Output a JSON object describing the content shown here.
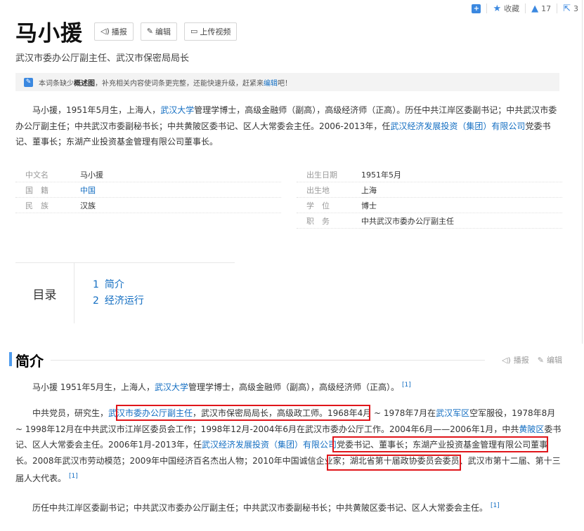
{
  "topbar": {
    "add_icon_label": "+",
    "collect": "收藏",
    "like_count": "17",
    "share_count": "3"
  },
  "title": "马小援",
  "title_buttons": {
    "report": "播报",
    "edit": "编辑",
    "upload_video": "上传视频"
  },
  "subtitle": "武汉市委办公厅副主任、武汉市保密局局长",
  "notice": {
    "text_before": "本词条缺少",
    "bold": "概述图",
    "text_middle": "，补充相关内容使词条更完整，还能快速升级，赶紧来",
    "link": "编辑",
    "text_after": "吧！"
  },
  "summary": {
    "p1": "马小援，1951年5月生，上海人，",
    "link1": "武汉大学",
    "p2": "管理学博士，高级金融师（副高），高级经济师（正高）。历任中共江岸区委副书记；中共武汉市委办公厅副主任；中共武汉市委副秘书长；中共黄陂区委书记、区人大常委会主任。2006-2013年，任",
    "link2": "武汉经济发展投资（集团）有限公司",
    "p3": "党委书记、董事长；东湖产业投资基金管理有限公司董事长。"
  },
  "info_left": [
    {
      "key": "中文名",
      "value": "马小援",
      "link": false
    },
    {
      "key": "国　籍",
      "value": "中国",
      "link": true
    },
    {
      "key": "民　族",
      "value": "汉族",
      "link": false
    }
  ],
  "info_right": [
    {
      "key": "出生日期",
      "value": "1951年5月"
    },
    {
      "key": "出生地",
      "value": "上海"
    },
    {
      "key": "学　位",
      "value": "博士"
    },
    {
      "key": "职　务",
      "value": "中共武汉市委办公厅副主任"
    }
  ],
  "toc": {
    "label": "目录",
    "items": [
      {
        "num": "1",
        "text": "简介"
      },
      {
        "num": "2",
        "text": "经济运行"
      }
    ]
  },
  "section": {
    "title": "简介",
    "report": "播报",
    "edit": "编辑"
  },
  "para1": {
    "a": "马小援 1951年5月生，上海人，",
    "link": "武汉大学",
    "b": "管理学博士，高级金融师（副高），高级经济师（正高）。",
    "ref": "[1]"
  },
  "para2": {
    "a": "中共党员，研究生，",
    "link1": "武汉市委办公厅副主任",
    "b": "，武汉市保密局局长，高级政工师。1968年4月 ~ 1978年7月在",
    "link2": "武汉军区",
    "c": "空军服役，1978年8月 ~ 1998年12月在中共武汉市江岸区委员会工作；1998年12月-2004年6月在武汉市委办公厅工作。2004年6月——2006年1月，中共",
    "link3": "黄陂区",
    "d": "委书记、区人大常委会主任。2006年1月-2013年，任",
    "link4": "武汉经济发展投资（集团）有限公司",
    "e": "党委书记、董事长；东湖产业投资基金管理有限公司董事长。2008年武汉市劳动模范；2009年中国经济百名杰出人物；2010年中国诚信企业家；湖北省第十届政协委员会委员、武汉市第十二届、第十三届人大代表。",
    "ref": "[1]"
  },
  "para3": {
    "a": "历任中共江岸区委副书记；中共武汉市委办公厅副主任；中共武汉市委副秘书长；中共黄陂区委书记、区人大常委会主任。",
    "ref": "[1]"
  }
}
